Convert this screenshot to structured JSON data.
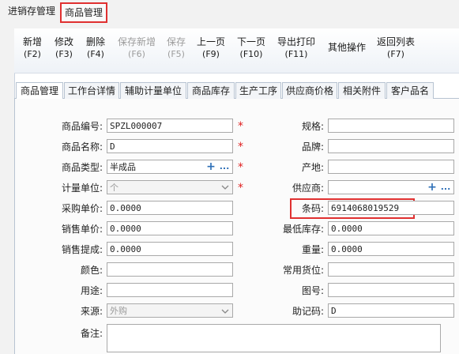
{
  "app_tabs": [
    "进销存管理",
    "商品管理"
  ],
  "toolbar": [
    {
      "label": "新增",
      "key": "(F2)",
      "enabled": true
    },
    {
      "label": "修改",
      "key": "(F3)",
      "enabled": true
    },
    {
      "label": "删除",
      "key": "(F4)",
      "enabled": true
    },
    {
      "label": "保存新增",
      "key": "(F6)",
      "enabled": false
    },
    {
      "label": "保存",
      "key": "(F5)",
      "enabled": false
    },
    {
      "label": "上一页",
      "key": "(F9)",
      "enabled": true
    },
    {
      "label": "下一页",
      "key": "(F10)",
      "enabled": true
    },
    {
      "label": "导出打印",
      "key": "(F11)",
      "enabled": true
    },
    {
      "label": "其他操作",
      "key": "",
      "enabled": true
    },
    {
      "label": "返回列表",
      "key": "(F7)",
      "enabled": true
    }
  ],
  "detail_tabs": [
    "商品管理",
    "工作台详情",
    "辅助计量单位",
    "商品库存",
    "生产工序",
    "供应商价格",
    "相关附件",
    "客户品名"
  ],
  "left_fields": [
    {
      "label": "商品编号:",
      "value": "SPZL000007",
      "required": true
    },
    {
      "label": "商品名称:",
      "value": "D",
      "required": true
    },
    {
      "label": "商品类型:",
      "value": "半成品",
      "required": true
    },
    {
      "label": "计量单位:",
      "value": "个",
      "required": true
    },
    {
      "label": "采购单价:",
      "value": "0.0000",
      "required": false
    },
    {
      "label": "销售单价:",
      "value": "0.0000",
      "required": false
    },
    {
      "label": "销售提成:",
      "value": "0.0000",
      "required": false
    },
    {
      "label": "颜色:",
      "value": "",
      "required": false
    },
    {
      "label": "用途:",
      "value": "",
      "required": false
    },
    {
      "label": "来源:",
      "value": "外购",
      "required": false
    },
    {
      "label": "备注:",
      "value": "",
      "required": false
    }
  ],
  "right_fields": [
    {
      "label": "规格:",
      "value": ""
    },
    {
      "label": "品牌:",
      "value": ""
    },
    {
      "label": "产地:",
      "value": ""
    },
    {
      "label": "供应商:",
      "value": ""
    },
    {
      "label": "条码:",
      "value": "6914068019529"
    },
    {
      "label": "最低库存:",
      "value": "0.0000"
    },
    {
      "label": "重量:",
      "value": "0.0000"
    },
    {
      "label": "常用货位:",
      "value": ""
    },
    {
      "label": "图号:",
      "value": ""
    },
    {
      "label": "助记码:",
      "value": "D"
    }
  ],
  "icons": {
    "add": "+",
    "more": "...",
    "dropdown": "chevron-down-icon",
    "required_mark": "*"
  },
  "colors": {
    "highlight": "#e03030",
    "required": "#e02020",
    "icon_blue": "#2d6fb7"
  }
}
